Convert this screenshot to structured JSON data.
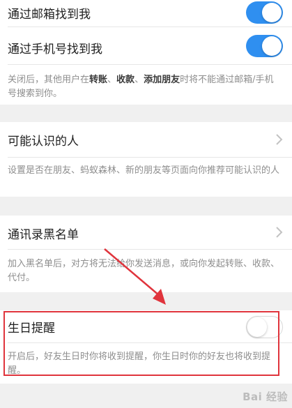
{
  "email_row": {
    "label": "通过邮箱找到我",
    "enabled": true
  },
  "phone_row": {
    "label": "通过手机号找到我",
    "enabled": true
  },
  "privacy_desc": {
    "part1": "关闭后，其他用户在",
    "bold1": "转账",
    "sep1": "、",
    "bold2": "收款",
    "sep2": "、",
    "bold3": "添加朋友",
    "part2": "时将不能通过邮箱/手机号搜索到你。"
  },
  "maybe_know": {
    "label": "可能认识的人",
    "desc": "设置是否在朋友、蚂蚁森林、新的朋友等页面向你推荐可能认识的人"
  },
  "blacklist": {
    "label": "通讯录黑名单",
    "desc": "加入黑名单后，对方将无法给你发送消息，或向你发起转账、收款、代付。"
  },
  "birthday": {
    "label": "生日提醒",
    "enabled": false,
    "desc": "开启后，好友生日时你将收到提醒，你生日时你的好友也将收到提醒。"
  },
  "watermark": "Bai 经验",
  "colors": {
    "toggle_on": "#2f8ff0",
    "annotation_red": "#e0343c"
  }
}
